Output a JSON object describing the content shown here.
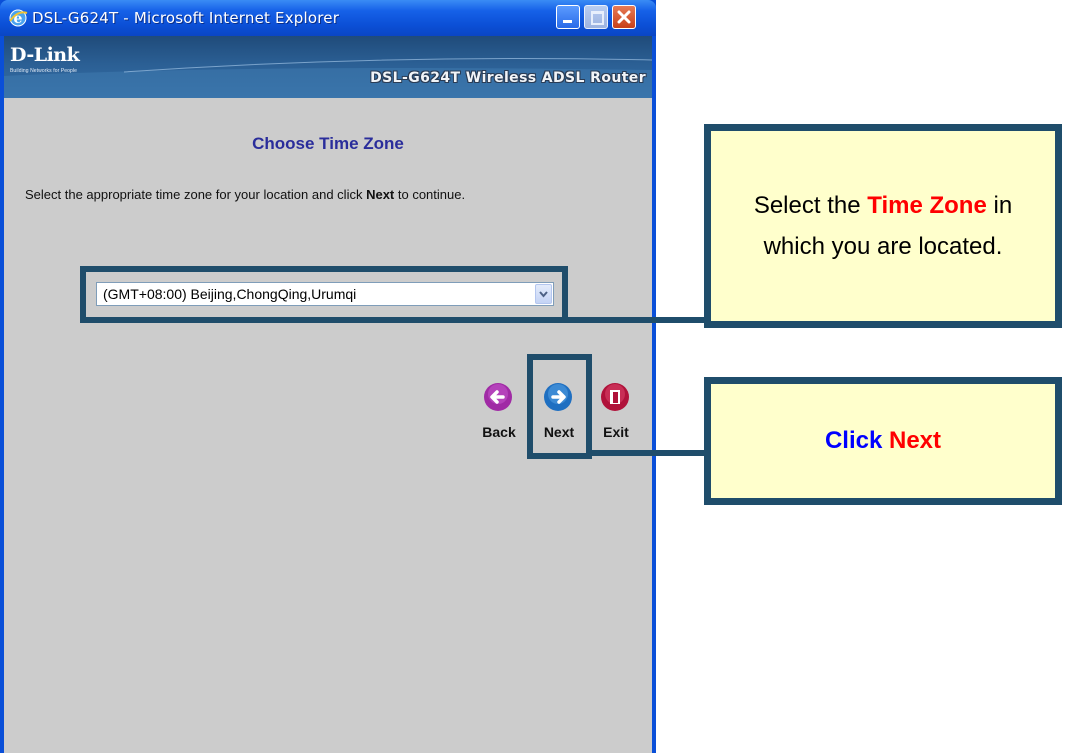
{
  "window": {
    "title": "DSL-G624T - Microsoft Internet Explorer"
  },
  "banner": {
    "logo": "D-Link",
    "tagline": "Building Networks for People",
    "product": "DSL-G624T Wireless ADSL Router"
  },
  "page": {
    "heading": "Choose Time Zone",
    "instruction_before": "Select the appropriate time zone for your location and click ",
    "instruction_bold": "Next",
    "instruction_after": " to continue."
  },
  "timezone": {
    "selected": "(GMT+08:00) Beijing,ChongQing,Urumqi"
  },
  "buttons": {
    "back": "Back",
    "next": "Next",
    "exit": "Exit"
  },
  "callouts": {
    "timezone": {
      "text1": "Select the ",
      "highlight": "Time Zone",
      "text2": " in which you are located."
    },
    "next": {
      "text1": "Click ",
      "highlight": "Next"
    }
  },
  "colors": {
    "frame": "#1f4d6b",
    "callout_bg": "#ffffcc",
    "heading": "#2a2d9b",
    "highlight_red": "#ff0000",
    "highlight_blue": "#0000ff"
  }
}
